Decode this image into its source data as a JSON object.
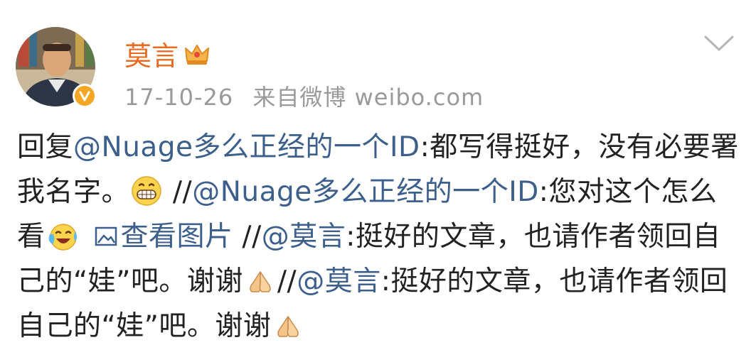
{
  "post": {
    "author": {
      "name": "莫言",
      "avatar_icon": "portrait-avatar",
      "verified_icon": "verified-v-badge",
      "member_icon": "crown-icon"
    },
    "meta": {
      "date": "17-10-26",
      "source": "来自微博 weibo.com"
    },
    "menu_icon": "chevron-down-icon",
    "content": {
      "reply_prefix": "回复",
      "mention_1": "@Nuage多么正经的一个ID",
      "text_1": ":都写得挺好，没有必要署我名字。",
      "emoji_1": "grin-emoji",
      "sep_1": " //",
      "mention_2": "@Nuage多么正经的一个ID",
      "text_2": ":您对这个怎么看",
      "emoji_2": "laugh-cry-emoji",
      "view_image": "查看图片",
      "sep_2": " //",
      "mention_3": "@莫言",
      "text_3": ":挺好的文章，也请作者领回自己的“娃”吧。谢谢",
      "emoji_3": "praying-hands-emoji",
      "sep_3": "//",
      "mention_4": "@莫言",
      "text_4": ":挺好的文章，也请作者领回自己的“娃”吧。谢谢",
      "emoji_4": "praying-hands-emoji"
    }
  },
  "colors": {
    "name": "#ea6b1f",
    "link": "#3c5f8c",
    "text": "#222222",
    "meta": "#9a9a9a",
    "verified": "#f5a623"
  }
}
